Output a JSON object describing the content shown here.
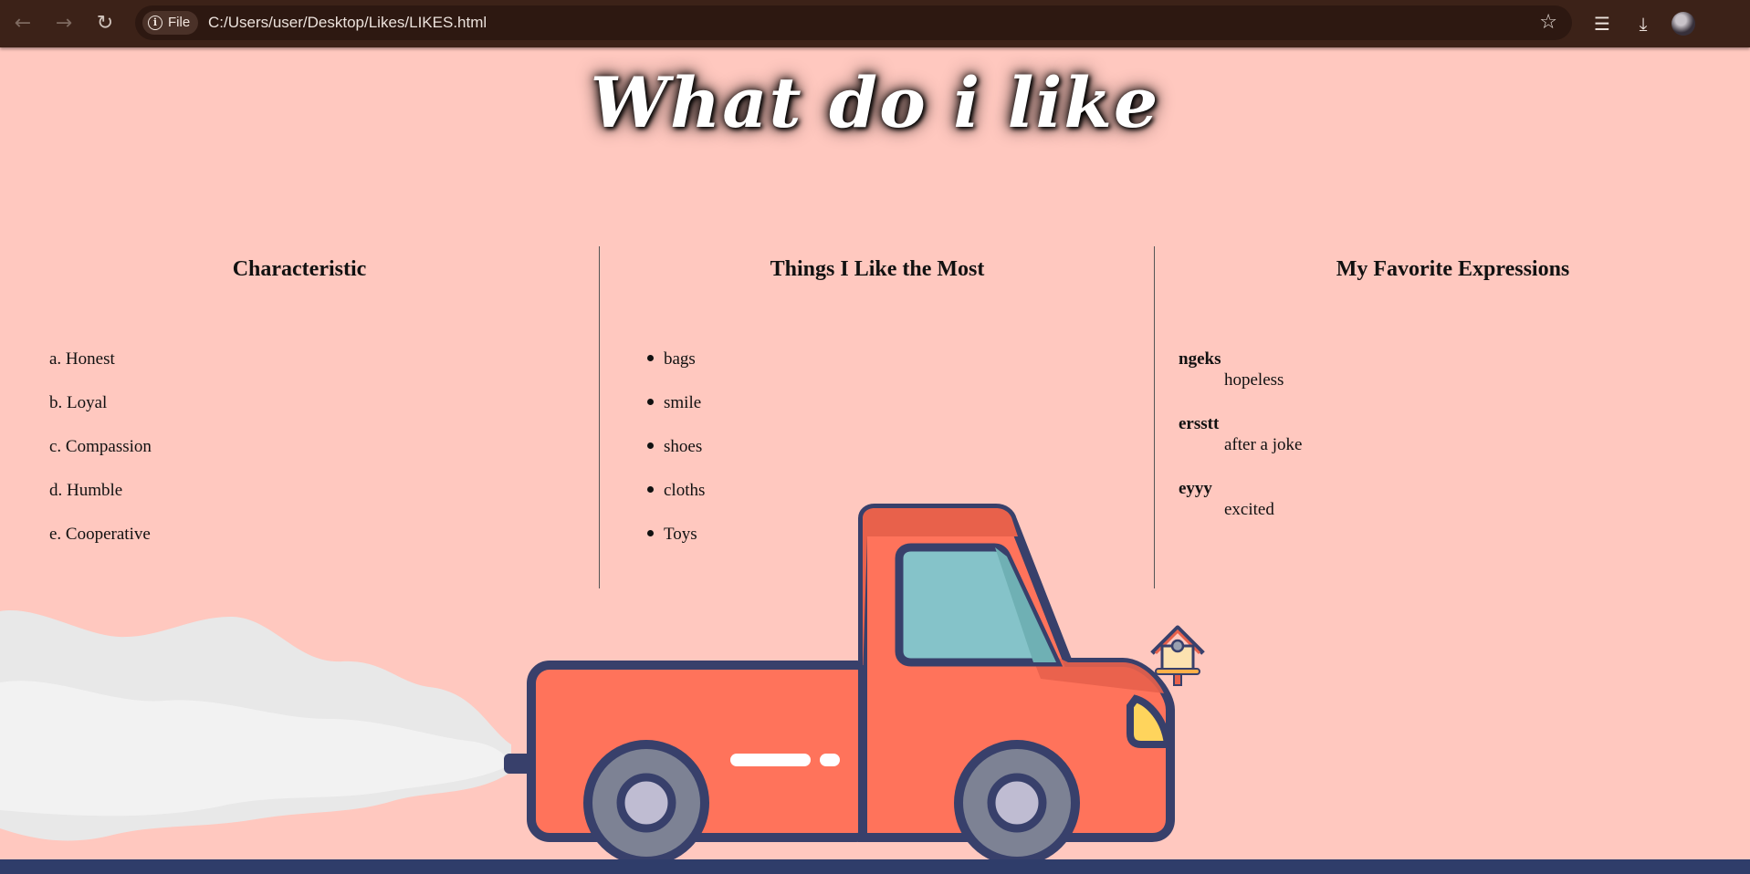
{
  "browser": {
    "chip_label": "File",
    "url": "C:/Users/user/Desktop/Likes/LIKES.html"
  },
  "page": {
    "title": "What do i like",
    "columns": [
      {
        "heading": "Characteristic",
        "items": [
          "a. Honest",
          "b. Loyal",
          "c. Compassion",
          "d. Humble",
          "e. Cooperative"
        ]
      },
      {
        "heading": "Things I Like the Most",
        "items": [
          "bags",
          "smile",
          "shoes",
          "cloths",
          "Toys"
        ]
      },
      {
        "heading": "My Favorite Expressions",
        "terms": [
          {
            "term": "ngeks",
            "definition": "hopeless"
          },
          {
            "term": "ersstt",
            "definition": "after a joke"
          },
          {
            "term": "eyyy",
            "definition": "excited"
          }
        ]
      }
    ]
  },
  "colors": {
    "background": "#ffc8bf",
    "truck_body": "#ff735b",
    "truck_outline": "#38406b",
    "ground": "#2f3d6a"
  },
  "icons": [
    "back-arrow-icon",
    "forward-arrow-icon",
    "reload-icon",
    "info-icon",
    "star-icon",
    "reading-list-icon",
    "download-icon",
    "avatar",
    "truck-illustration",
    "birdhouse-icon",
    "smoke-illustration"
  ]
}
